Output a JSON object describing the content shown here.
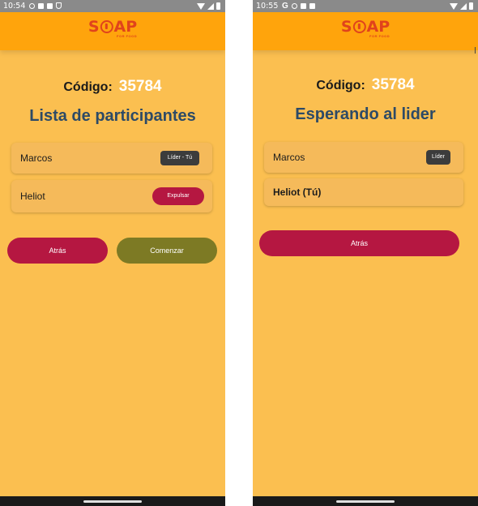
{
  "colors": {
    "background": "#fbbf50",
    "appbar": "#ffa40c",
    "logo": "#e0431c",
    "code_value": "#ffffff",
    "title": "#2d4a66",
    "card": "#f5ba5a",
    "badge": "#3c3c3c",
    "primary_red": "#b51741",
    "start_green": "#7d7a24"
  },
  "logo": {
    "text_before": "S",
    "text_after": "AP",
    "sub": "FOR FOOD"
  },
  "left": {
    "status": {
      "time": "10:54",
      "icons": [
        "vpn-icon",
        "notification-icon",
        "notification-icon",
        "shield-icon"
      ]
    },
    "code_label": "Código:",
    "code_value": "35784",
    "title": "Lista de participantes",
    "participants": [
      {
        "name": "Marcos",
        "tag": "Líder - Tú"
      },
      {
        "name": "Heliot",
        "action": "Expulsar"
      }
    ],
    "back_button": "Atrás",
    "start_button": "Comenzar"
  },
  "right": {
    "status": {
      "time": "10:55",
      "icons": [
        "google-icon",
        "vpn-icon",
        "notification-icon",
        "notification-icon"
      ]
    },
    "code_label": "Código:",
    "code_value": "35784",
    "title": "Esperando al lider",
    "participants": [
      {
        "name": "Marcos",
        "tag": "Líder"
      },
      {
        "name": "Heliot (Tú)"
      }
    ],
    "back_button": "Atrás"
  }
}
